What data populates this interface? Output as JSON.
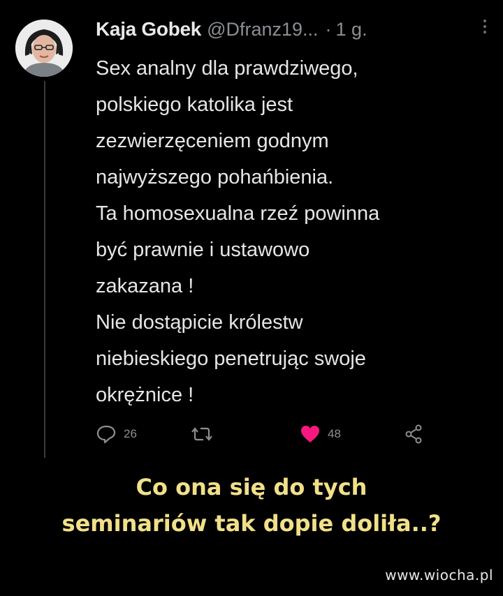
{
  "tweet": {
    "author_name": "Kaja Gobek",
    "handle": "@Dfranz19...",
    "separator": "·",
    "time": "1 g.",
    "more_icon": "vertical-dots-icon",
    "body_lines": [
      "Sex analny dla prawdziwego,",
      "polskiego katolika jest",
      "zezwierzęceniem godnym",
      "najwyższego pohańbienia.",
      "Ta homosexualna rzeź powinna",
      "być prawnie i ustawowo",
      "zakazana !",
      "Nie dostąpicie królestw",
      "niebieskiego penetrując swoje",
      "okrężnice !"
    ],
    "actions": {
      "reply": {
        "icon": "reply-bubble-icon",
        "count": "26"
      },
      "retweet": {
        "icon": "retweet-icon",
        "count": ""
      },
      "like": {
        "icon": "heart-icon",
        "count": "48",
        "color": "#f91880"
      },
      "share": {
        "icon": "share-icon"
      }
    }
  },
  "caption": {
    "lines": [
      "Co ona się  do tych",
      "seminariów tak dopie doliła..?"
    ],
    "color": "#f1e089"
  },
  "watermark": "www.wiocha.pl"
}
